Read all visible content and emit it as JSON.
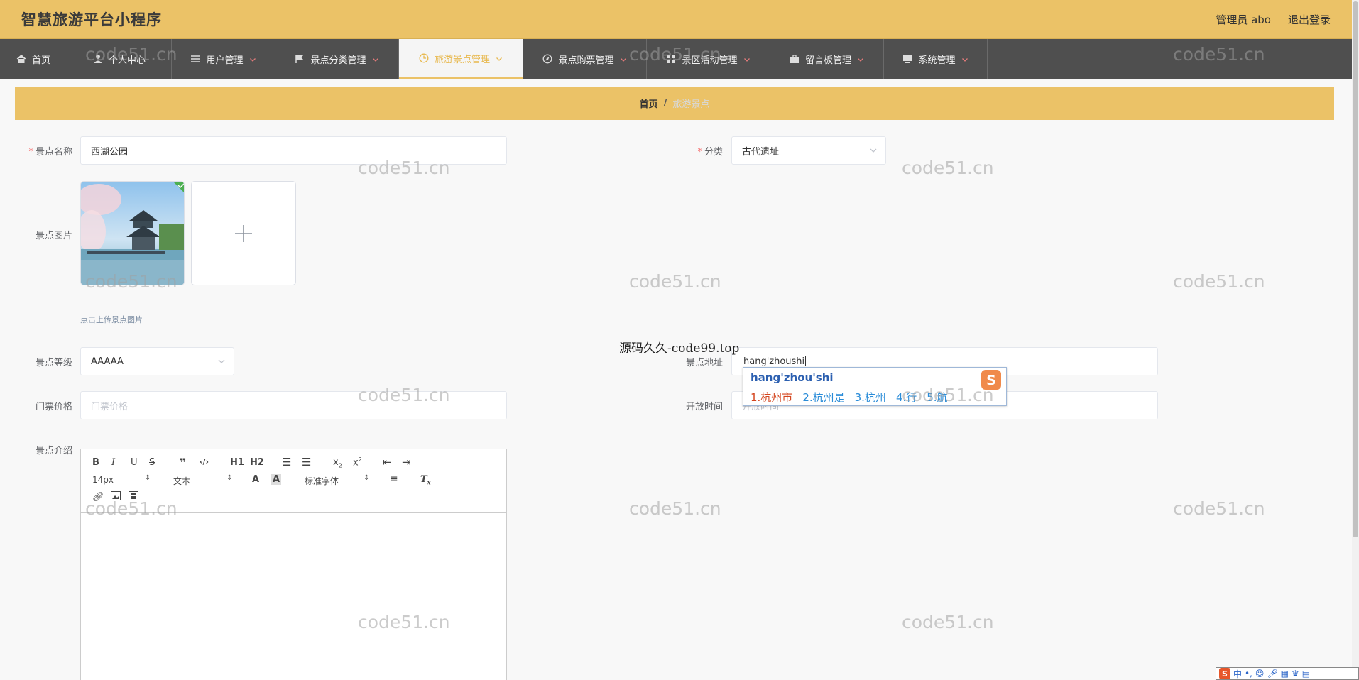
{
  "header": {
    "title": "智慧旅游平台小程序",
    "admin_label": "管理员 abo",
    "logout_label": "退出登录"
  },
  "nav": [
    {
      "label": "首页",
      "icon": "home-icon"
    },
    {
      "label": "个人中心",
      "icon": "user-icon"
    },
    {
      "label": "用户管理",
      "icon": "list-icon"
    },
    {
      "label": "景点分类管理",
      "icon": "flag-icon"
    },
    {
      "label": "旅游景点管理",
      "icon": "clock-icon",
      "active": true
    },
    {
      "label": "景点购票管理",
      "icon": "compass-icon"
    },
    {
      "label": "景区活动管理",
      "icon": "grid-icon"
    },
    {
      "label": "留言板管理",
      "icon": "bag-icon"
    },
    {
      "label": "系统管理",
      "icon": "monitor-icon"
    }
  ],
  "breadcrumb": {
    "home": "首页",
    "separator": "/",
    "current": "旅游景点"
  },
  "form": {
    "name_label": "景点名称",
    "name_value": "西湖公园",
    "category_label": "分类",
    "category_value": "古代遗址",
    "image_label": "景点图片",
    "image_tip": "点击上传景点图片",
    "level_label": "景点等级",
    "level_value": "AAAAA",
    "address_label": "景点地址",
    "address_value": "hang'zhoushi",
    "price_label": "门票价格",
    "price_placeholder": "门票价格",
    "open_label": "开放时间",
    "open_placeholder": "开放时间",
    "intro_label": "景点介绍"
  },
  "editor": {
    "font_size": "14px",
    "block_type": "文本",
    "font_family": "标准字体",
    "h1": "H1",
    "h2": "H2"
  },
  "overlay_text": "源码久久-code99.top",
  "ime": {
    "pinyin": "hang'zhou'shi",
    "candidates": [
      "1.杭州市",
      "2.杭州是",
      "3.杭州",
      "4.行",
      "5.航"
    ]
  },
  "watermark": "code51.cn",
  "tray": {
    "s_label": "S",
    "lang": "中"
  },
  "colors": {
    "accent": "#ebc267",
    "nav_bg": "#4f4f4f",
    "active_text": "#e8b94f"
  }
}
